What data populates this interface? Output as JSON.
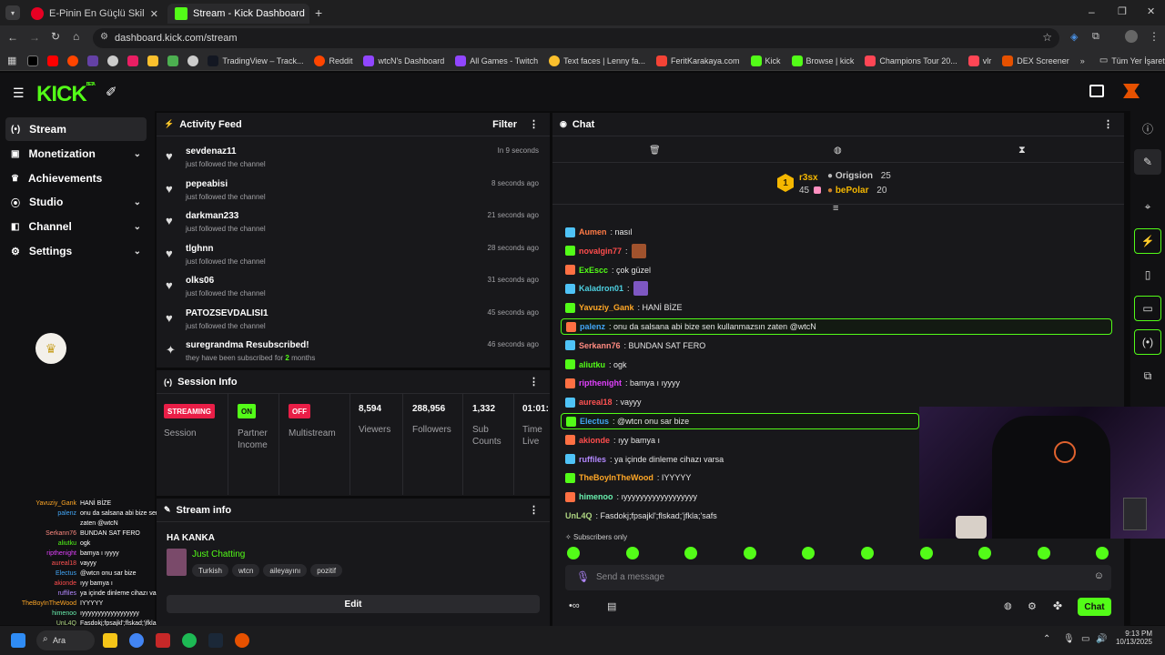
{
  "browser": {
    "tabs": [
      {
        "title": "E-Pinin En Güçlü Skilli - Pindinin",
        "icon": "pinterest-icon"
      },
      {
        "title": "Stream - Kick Dashboard",
        "icon": "kick-icon"
      }
    ],
    "url": "dashboard.kick.com/stream",
    "bookmarks": [
      "TradingView – Track...",
      "Reddit",
      "wtcN's Dashboard",
      "All Games - Twitch",
      "Text faces | Lenny fa...",
      "FeritKarakaya.com",
      "Kick",
      "Browse | kick",
      "Champions Tour 20...",
      "vlr",
      "DEX Screener"
    ],
    "all_bookmarks": "Tüm Yer İşaretleri"
  },
  "kick": {
    "logo": "KICK",
    "logo_beta": "BETA"
  },
  "sidebar": {
    "items": [
      {
        "label": "Stream",
        "icon": "radio-icon"
      },
      {
        "label": "Monetization",
        "icon": "money-icon"
      },
      {
        "label": "Achievements",
        "icon": "trophy-icon"
      },
      {
        "label": "Studio",
        "icon": "camera-icon"
      },
      {
        "label": "Channel",
        "icon": "channel-icon"
      },
      {
        "label": "Settings",
        "icon": "gear-icon"
      }
    ]
  },
  "activity": {
    "title": "Activity Feed",
    "filter": "Filter",
    "items": [
      {
        "name": "sevdenaz11",
        "sub": "just followed the channel",
        "time": "In 9 seconds"
      },
      {
        "name": "pepeabisi",
        "sub": "just followed the channel",
        "time": "8 seconds ago"
      },
      {
        "name": "darkman233",
        "sub": "just followed the channel",
        "time": "21 seconds ago"
      },
      {
        "name": "tlghnn",
        "sub": "just followed the channel",
        "time": "28 seconds ago"
      },
      {
        "name": "olks06",
        "sub": "just followed the channel",
        "time": "31 seconds ago"
      },
      {
        "name": "PATOZSEVDALISI1",
        "sub": "just followed the channel",
        "time": "45 seconds ago"
      },
      {
        "name": "suregrandma Resubscribed!",
        "sub_prefix": "they have been subscribed for ",
        "sub_num": "2",
        "sub_suffix": " months",
        "time": "46 seconds ago"
      }
    ]
  },
  "session": {
    "title": "Session Info",
    "streaming_badge": "STREAMING",
    "session_label": "Session",
    "partner_badge": "ON",
    "partner_label1": "Partner",
    "partner_label2": "Income",
    "multistream_badge": "OFF",
    "multistream_label": "Multistream",
    "viewers": "8,594",
    "viewers_label": "Viewers",
    "followers": "288,956",
    "followers_label": "Followers",
    "subs": "1,332",
    "subs_label1": "Sub",
    "subs_label2": "Counts",
    "time": "01:01:",
    "time_label1": "Time",
    "time_label2": "Live"
  },
  "streaminfo": {
    "title": "Stream info",
    "stream_title": "HA KANKA",
    "category": "Just Chatting",
    "tags": [
      "Turkish",
      "wtcn",
      "aileyayını",
      "pozitif"
    ],
    "edit": "Edit"
  },
  "chat": {
    "title": "Chat",
    "leaderboard": {
      "first_rank": "1",
      "first_name": "r3sx",
      "first_count": "45",
      "second_name": "Origsion",
      "second_count": "25",
      "third_name": "bePolar",
      "third_count": "20"
    },
    "messages": [
      {
        "user": "Aumen",
        "text": ": nasıl",
        "color": "#ff7a45"
      },
      {
        "user": "novalgin77",
        "text": ":",
        "color": "#ff4d4d"
      },
      {
        "user": "ExEscc",
        "text": ": çok güzel",
        "color": "#53fc18"
      },
      {
        "user": "Kaladron01",
        "text": ":",
        "color": "#4dd0e1"
      },
      {
        "user": "Yavuziy_Gank",
        "text": ": HANİ BİZE",
        "color": "#ffa726"
      },
      {
        "user": "palenz",
        "text": ": onu da salsana abi bize sen kullanmazsın zaten @wtcN",
        "color": "#42a5f5"
      },
      {
        "user": "Serkann76",
        "text": ": BUNDAN SAT FERO",
        "color": "#ff8a80"
      },
      {
        "user": "aliutku",
        "text": ": ogk",
        "color": "#53fc18"
      },
      {
        "user": "ripthenight",
        "text": ": bamya ı ıyyyy",
        "color": "#e040fb"
      },
      {
        "user": "aureal18",
        "text": ": vayyy",
        "color": "#ff5252"
      },
      {
        "user": "Electus",
        "text": ": @wtcn onu sar bize",
        "color": "#42a5f5"
      },
      {
        "user": "akionde",
        "text": ": ıyy bamya ı",
        "color": "#ff4d4d"
      },
      {
        "user": "ruffiles",
        "text": ": ya içinde dinleme cihazı varsa",
        "color": "#b388ff"
      },
      {
        "user": "TheBoyInTheWood",
        "text": ": IYYYYY",
        "color": "#ffa726"
      },
      {
        "user": "himenoo",
        "text": ": ıyyyyyyyyyyyyyyyyyy",
        "color": "#69f0ae"
      },
      {
        "user": "UnL4Q",
        "text": ": Fasdokj;fpsajkl';flskad;'jfkla;'safs",
        "color": "#aed581"
      }
    ],
    "subscribers_only": "Subscribers only",
    "placeholder": "Send a message",
    "send": "Chat"
  },
  "overlay_chat": [
    {
      "user": "Yavuziy_Gank",
      "text": "HANİ BİZE",
      "color": "#ffa726"
    },
    {
      "user": "palenz",
      "text": "onu da salsana abi bize sen kullanmazsın",
      "color": "#42a5f5"
    },
    {
      "user": "",
      "text": "zaten @wtcN",
      "color": "#fff"
    },
    {
      "user": "Serkann76",
      "text": "BUNDAN SAT FERO",
      "color": "#ff8a80"
    },
    {
      "user": "aliutku",
      "text": "ogk",
      "color": "#53fc18"
    },
    {
      "user": "ripthenight",
      "text": "bamya ı ıyyyy",
      "color": "#e040fb"
    },
    {
      "user": "aureal18",
      "text": "vayyy",
      "color": "#ff5252"
    },
    {
      "user": "Electus",
      "text": "@wtcn onu sar bize",
      "color": "#42a5f5"
    },
    {
      "user": "akionde",
      "text": "ıyy bamya ı",
      "color": "#ff4d4d"
    },
    {
      "user": "ruffiles",
      "text": "ya içinde dinleme cihazı varsa",
      "color": "#b388ff"
    },
    {
      "user": "TheBoyInTheWood",
      "text": "IYYYYY",
      "color": "#ffa726"
    },
    {
      "user": "himenoo",
      "text": "ıyyyyyyyyyyyyyyyyyy",
      "color": "#69f0ae"
    },
    {
      "user": "UnL4Q",
      "text": "Fasdokj;fpsajkl';flskad;'jfkla;'safs",
      "color": "#aed581"
    }
  ],
  "taskbar": {
    "search": "Ara",
    "time": "9:13 PM",
    "date": "10/13/2025"
  },
  "colors": {
    "accent": "#53fc18",
    "streaming": "#e91e47",
    "off": "#e91e47"
  }
}
